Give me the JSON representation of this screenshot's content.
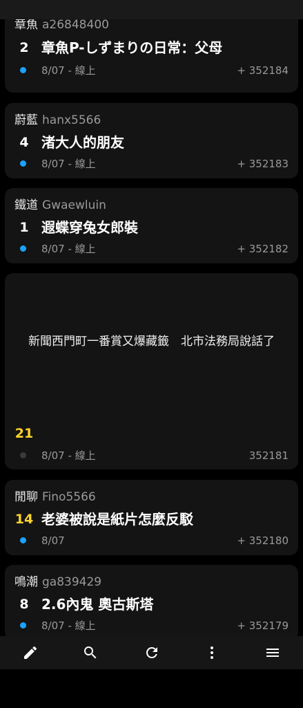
{
  "posts": [
    {
      "board": "章魚",
      "user": "a26848400",
      "count": "2",
      "title": "章魚P-しずまりの日常：父母",
      "date": "8/07 - 線上",
      "id": "+ 352184"
    },
    {
      "board": "蔚藍",
      "user": "hanx5566",
      "count": "4",
      "title": "渚大人的朋友",
      "date": "8/07 - 線上",
      "id": "+ 352183"
    },
    {
      "board": "鐵道",
      "user": "Gwaewluin",
      "count": "1",
      "title": "遐蝶穿兔女郎裝",
      "date": "8/07 - 線上",
      "id": "+ 352182"
    }
  ],
  "ad": {
    "text": "新聞西門町一番賞又爆藏籤　北市法務局說話了",
    "count": "21",
    "date": "8/07 - 線上",
    "id": "352181"
  },
  "posts2": [
    {
      "board": "閒聊",
      "user": "Fino5566",
      "count": "14",
      "title": "老婆被說是紙片怎麼反駁",
      "date": "8/07",
      "id": "+ 352180"
    },
    {
      "board": "鳴潮",
      "user": "ga839429",
      "count": "8",
      "title": "2.6內鬼 奧古斯塔",
      "date": "8/07 - 線上",
      "id": "+ 352179"
    }
  ],
  "toolbar": [
    "edit-icon",
    "search-icon",
    "refresh-icon",
    "more-vert-icon",
    "menu-icon"
  ],
  "colors": {
    "unread_dot": "#1aa3ff",
    "hot_count": "#ffd42a",
    "card_bg": "#141414"
  }
}
